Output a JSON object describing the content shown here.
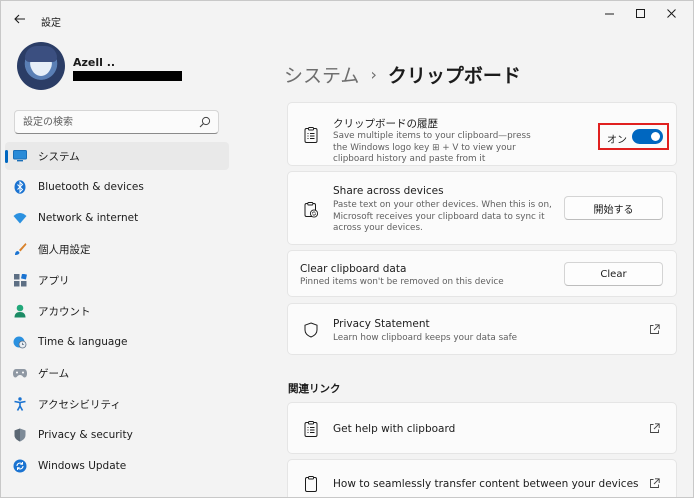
{
  "app": {
    "title": "設定"
  },
  "user": {
    "name": "Azell .."
  },
  "search": {
    "placeholder": "設定の検索"
  },
  "nav": {
    "items": [
      {
        "label": "システム",
        "icon": "system-display-icon",
        "active": true
      },
      {
        "label": "Bluetooth & devices",
        "icon": "bluetooth-icon"
      },
      {
        "label": "Network & internet",
        "icon": "wifi-icon"
      },
      {
        "label": "個人用設定",
        "icon": "brush-icon"
      },
      {
        "label": "アプリ",
        "icon": "apps-icon"
      },
      {
        "label": "アカウント",
        "icon": "account-icon"
      },
      {
        "label": "Time & language",
        "icon": "globe-clock-icon"
      },
      {
        "label": "ゲーム",
        "icon": "gamepad-icon"
      },
      {
        "label": "アクセシビリティ",
        "icon": "accessibility-icon"
      },
      {
        "label": "Privacy & security",
        "icon": "shield-icon"
      },
      {
        "label": "Windows Update",
        "icon": "update-icon"
      }
    ]
  },
  "breadcrumb": {
    "parent": "システム",
    "separator": "›",
    "current": "クリップボード"
  },
  "history_card": {
    "title": "クリップボードの履歴",
    "desc_line1": "Save multiple items to your clipboard—press",
    "desc_line2": "the Windows logo key ⊞ + V to view your",
    "desc_line3": "clipboard history and paste from it",
    "toggle_label": "オン",
    "toggle_on": true
  },
  "share_card": {
    "title": "Share across devices",
    "desc_line1": "Paste text on your other devices. When this is on,",
    "desc_line2": "Microsoft receives your clipboard data to sync it",
    "desc_line3": "across your devices.",
    "button": "開始する"
  },
  "clear_card": {
    "title": "Clear clipboard data",
    "desc": "Pinned items won't be removed on this device",
    "button": "Clear"
  },
  "privacy_card": {
    "title": "Privacy Statement",
    "desc": "Learn how clipboard keeps your data safe"
  },
  "related": {
    "header": "関連リンク",
    "links": [
      {
        "label": "Get help with clipboard"
      },
      {
        "label": "How to seamlessly transfer content between your devices"
      }
    ]
  },
  "colors": {
    "accent": "#0067c0",
    "highlight_border": "#e0201f"
  }
}
